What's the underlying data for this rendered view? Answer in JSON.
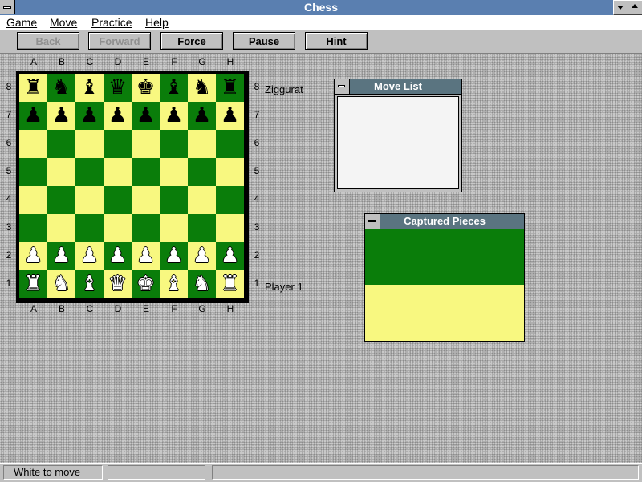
{
  "window": {
    "title": "Chess"
  },
  "menu": [
    {
      "label": "Game"
    },
    {
      "label": "Move"
    },
    {
      "label": "Practice"
    },
    {
      "label": "Help"
    }
  ],
  "toolbar": {
    "back_label": "Back",
    "forward_label": "Forward",
    "force_label": "Force",
    "pause_label": "Pause",
    "hint_label": "Hint"
  },
  "board": {
    "files": [
      "A",
      "B",
      "C",
      "D",
      "E",
      "F",
      "G",
      "H"
    ],
    "ranks": [
      "8",
      "7",
      "6",
      "5",
      "4",
      "3",
      "2",
      "1"
    ],
    "light_color": "#f8f880",
    "dark_color": "#0a7d0a",
    "position": [
      [
        "bR",
        "bN",
        "bB",
        "bQ",
        "bK",
        "bB",
        "bN",
        "bR"
      ],
      [
        "bP",
        "bP",
        "bP",
        "bP",
        "bP",
        "bP",
        "bP",
        "bP"
      ],
      [
        "",
        "",
        "",
        "",
        "",
        "",
        "",
        ""
      ],
      [
        "",
        "",
        "",
        "",
        "",
        "",
        "",
        ""
      ],
      [
        "",
        "",
        "",
        "",
        "",
        "",
        "",
        ""
      ],
      [
        "",
        "",
        "",
        "",
        "",
        "",
        "",
        ""
      ],
      [
        "wP",
        "wP",
        "wP",
        "wP",
        "wP",
        "wP",
        "wP",
        "wP"
      ],
      [
        "wR",
        "wN",
        "wB",
        "wQ",
        "wK",
        "wB",
        "wN",
        "wR"
      ]
    ]
  },
  "players": {
    "top": "Ziggurat",
    "bottom": "Player 1"
  },
  "move_list": {
    "title": "Move List",
    "moves": []
  },
  "captured": {
    "title": "Captured Pieces"
  },
  "status": {
    "message": "White to move"
  }
}
